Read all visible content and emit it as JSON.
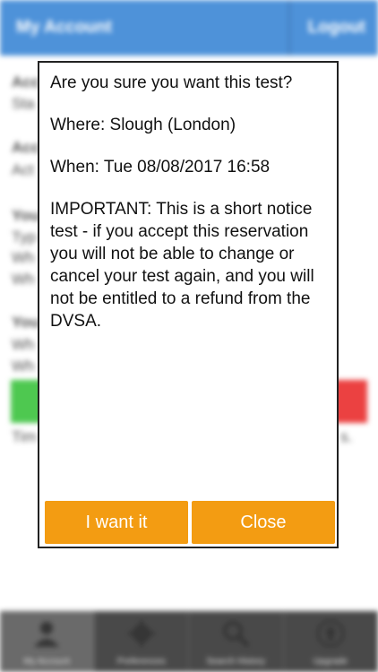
{
  "header": {
    "title": "My Account",
    "logout_label": "Logout"
  },
  "background_fragments": {
    "row1_bold": "Acc",
    "row1": "Sta",
    "row2_bold": "Acc",
    "row2": "Act",
    "row3_bold": "You",
    "row3a": "Typ",
    "row3b": "Wh",
    "row3c": "Wh",
    "row4_bold": "You",
    "row4a": "Wh",
    "row4b": "Wh",
    "footer_left": "Tim",
    "footer_right": "s."
  },
  "dialog": {
    "question": "Are you sure you want this test?",
    "where": "Where: Slough (London)",
    "when": "When: Tue 08/08/2017 16:58",
    "important": "IMPORTANT: This is a short notice test - if you accept this reservation you will not be able to change or cancel your test again, and you will not be entitled to a refund from the DVSA.",
    "accept_label": "I want it",
    "close_label": "Close"
  },
  "tabs": [
    {
      "label": "My Account",
      "icon": "user-icon",
      "active": true
    },
    {
      "label": "Preferences",
      "icon": "gear-icon",
      "active": false
    },
    {
      "label": "Search History",
      "icon": "search-icon",
      "active": false
    },
    {
      "label": "Upgrade",
      "icon": "upgrade-icon",
      "active": false
    }
  ],
  "colors": {
    "header": "#2f7fd3",
    "accept": "#f39c12",
    "green": "#2fbf32",
    "red": "#e82020",
    "tabbar": "#2a2a2a"
  }
}
